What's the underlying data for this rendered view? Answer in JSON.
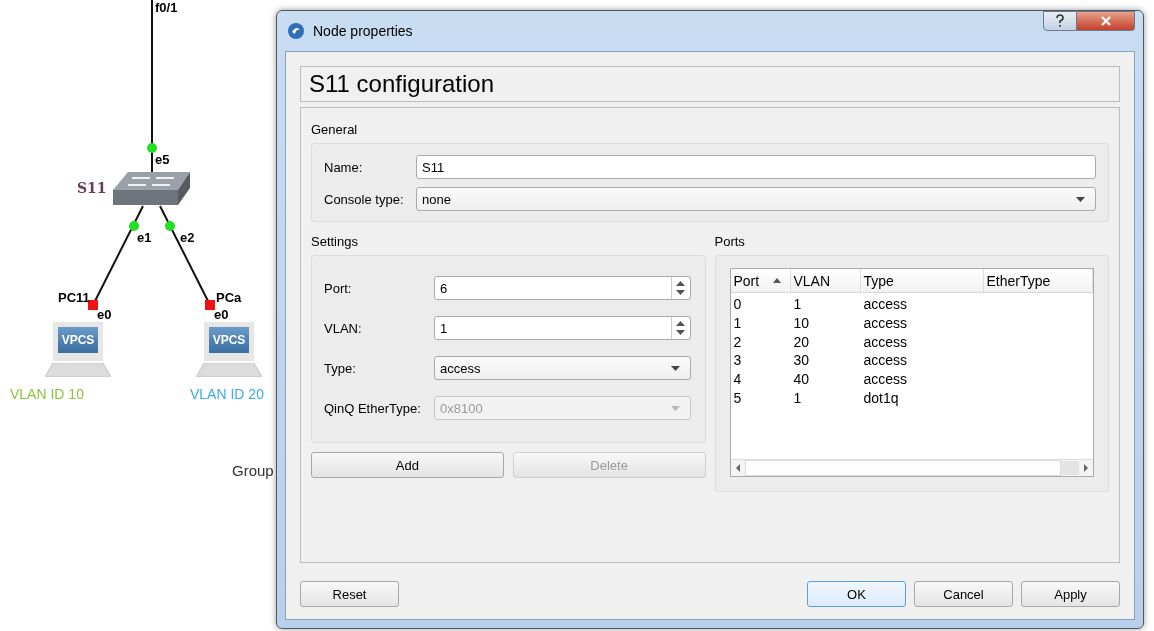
{
  "topology": {
    "uplink_port": "f0/1",
    "switch": {
      "label": "S11",
      "port": "e5"
    },
    "hosts": [
      {
        "label": "PC11",
        "switch_port": "e1",
        "port": "e0",
        "screen_text": "VPCS",
        "note": "VLAN ID 10",
        "color": "#8cc43c"
      },
      {
        "label": "PCa",
        "switch_port": "e2",
        "port": "e0",
        "screen_text": "VPCS",
        "note": "VLAN ID 20",
        "color": "#3aaaf0"
      }
    ],
    "group_label": "Group"
  },
  "window": {
    "title": "Node properties"
  },
  "heading": "S11 configuration",
  "general": {
    "title": "General",
    "fields": [
      {
        "kind": "text",
        "label": "Name:",
        "value": "S11",
        "disabled": false
      },
      {
        "kind": "dropdown",
        "label": "Console type:",
        "value": "none",
        "disabled": false
      }
    ]
  },
  "settings": {
    "title": "Settings",
    "fields": [
      {
        "kind": "spin",
        "label": "Port:",
        "value": "6",
        "disabled": false
      },
      {
        "kind": "spin",
        "label": "VLAN:",
        "value": "1",
        "disabled": false
      },
      {
        "kind": "dropdown",
        "label": "Type:",
        "value": "access",
        "disabled": false
      },
      {
        "kind": "dropdown",
        "label": "QinQ EtherType:",
        "value": "0x8100",
        "disabled": true
      }
    ],
    "buttons": [
      {
        "label": "Add",
        "disabled": false
      },
      {
        "label": "Delete",
        "disabled": true
      }
    ]
  },
  "ports": {
    "title": "Ports",
    "columns": [
      {
        "label": "Port",
        "sorted": true
      },
      {
        "label": "VLAN",
        "sorted": false
      },
      {
        "label": "Type",
        "sorted": false
      },
      {
        "label": "EtherType",
        "sorted": false
      }
    ],
    "rows": [
      [
        "0",
        "1",
        "access"
      ],
      [
        "1",
        "10",
        "access"
      ],
      [
        "2",
        "20",
        "access"
      ],
      [
        "3",
        "30",
        "access"
      ],
      [
        "4",
        "40",
        "access"
      ],
      [
        "5",
        "1",
        "dot1q"
      ]
    ]
  },
  "footer": {
    "buttons": [
      {
        "label": "Reset",
        "default": false
      },
      {
        "label": "OK",
        "default": true
      },
      {
        "label": "Cancel",
        "default": false
      },
      {
        "label": "Apply",
        "default": false
      }
    ]
  }
}
